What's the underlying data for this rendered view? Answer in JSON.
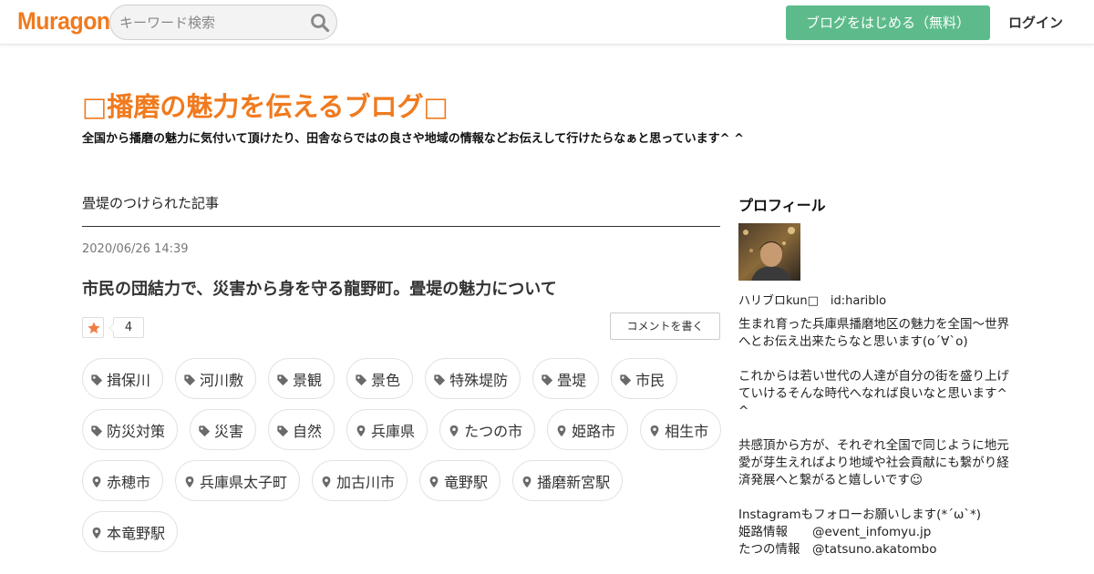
{
  "header": {
    "logo": "Muragon",
    "search_placeholder": "キーワード検索",
    "signup_label": "ブログをはじめる（無料）",
    "login_label": "ログイン"
  },
  "blog": {
    "title": "□播磨の魅力を伝えるブログ□",
    "description": "全国から播磨の魅力に気付いて頂けたり、田舎ならではの良さや地域の情報などお伝えして行けたらなぁと思っています^ ^"
  },
  "main": {
    "section_heading": "畳堤のつけられた記事",
    "post": {
      "date": "2020/06/26 14:39",
      "title": "市民の団結力で、災害から身を守る龍野町。畳堤の魅力について",
      "like_count": "4",
      "comment_button": "コメントを書く",
      "tags": [
        {
          "icon": "tag-icon",
          "label": "揖保川"
        },
        {
          "icon": "tag-icon",
          "label": "河川敷"
        },
        {
          "icon": "tag-icon",
          "label": "景観"
        },
        {
          "icon": "tag-icon",
          "label": "景色"
        },
        {
          "icon": "tag-icon",
          "label": "特殊堤防"
        },
        {
          "icon": "tag-icon",
          "label": "畳堤"
        },
        {
          "icon": "tag-icon",
          "label": "市民"
        },
        {
          "icon": "tag-icon",
          "label": "防災対策"
        },
        {
          "icon": "tag-icon",
          "label": "災害"
        },
        {
          "icon": "tag-icon",
          "label": "自然"
        },
        {
          "icon": "pin-icon",
          "label": "兵庫県"
        },
        {
          "icon": "pin-icon",
          "label": "たつの市"
        },
        {
          "icon": "pin-icon",
          "label": "姫路市"
        },
        {
          "icon": "pin-icon",
          "label": "相生市"
        },
        {
          "icon": "pin-icon",
          "label": "赤穂市"
        },
        {
          "icon": "pin-icon",
          "label": "兵庫県太子町"
        },
        {
          "icon": "pin-icon",
          "label": "加古川市"
        },
        {
          "icon": "pin-icon",
          "label": "竜野駅"
        },
        {
          "icon": "pin-icon",
          "label": "播磨新宮駅"
        },
        {
          "icon": "pin-icon",
          "label": "本竜野駅"
        }
      ]
    }
  },
  "sidebar": {
    "heading": "プロフィール",
    "name": "ハリブロkun□　id:hariblo",
    "bio": {
      "p1": "生まれ育った兵庫県播磨地区の魅力を全国〜世界へとお伝え出来たらなと思います(o´∀`o)",
      "p2": "これからは若い世代の人達が自分の街を盛り上げていけるそんな時代へなれば良いなと思います^ ^",
      "p3": "共感頂から方が、それぞれ全国で同じように地元愛が芽生えればより地域や社会貢献にも繋がり経済発展へと繋がると嬉しいです☺",
      "p4_line1": "Instagramもフォローお願いします(*´ω`*)",
      "p4_line2": "姫路情報　　@event_infomyu.jp",
      "p4_line3": "たつの情報　@tatsuno.akatombo"
    }
  },
  "colors": {
    "brand_orange": "#f07a1e",
    "signup_green": "#5dbb8b",
    "star_orange": "#ef7d45"
  }
}
